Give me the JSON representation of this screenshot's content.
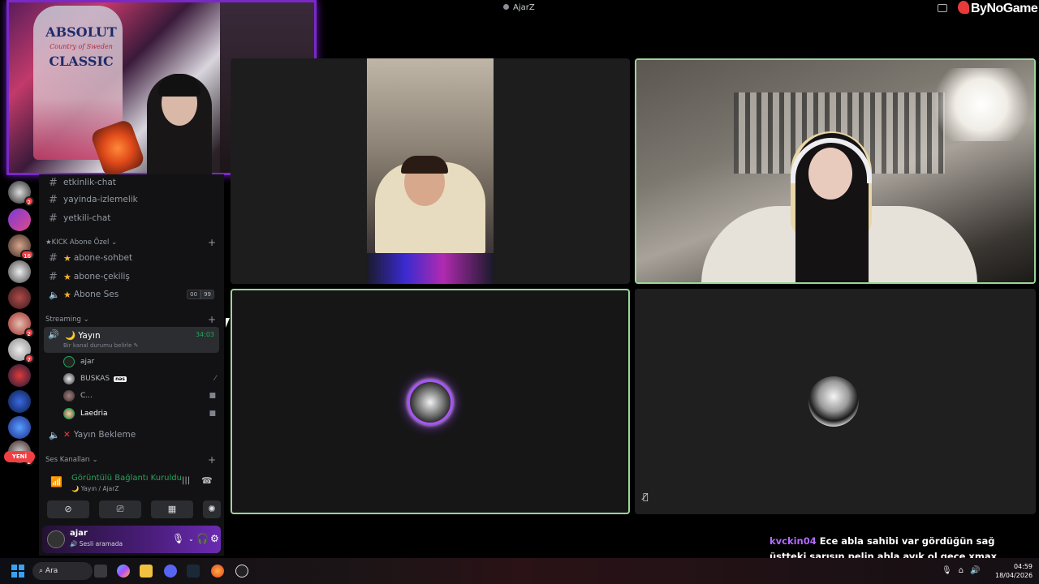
{
  "window": {
    "title": "AjarZ"
  },
  "overlay": {
    "brand": "ByNoGame",
    "webcam": {
      "bottle_line1": "ABSOLUT",
      "bottle_line2": "Country of Sweden",
      "bottle_line3": "CLASSIC"
    }
  },
  "rail": {
    "new_badge": "YENİ",
    "badges": [
      "2",
      "16",
      "2",
      "7",
      "2"
    ]
  },
  "sidebar": {
    "channels_top": [
      {
        "name": "etkinlik-chat"
      },
      {
        "name": "yayinda-izlemelik"
      },
      {
        "name": "yetkili-chat"
      }
    ],
    "category_kick": "KICK Abone Özel",
    "kick_channels": [
      {
        "name": "abone-sohbet"
      },
      {
        "name": "abone-çekiliş"
      },
      {
        "name": "Abone Ses",
        "count_a": "00",
        "count_b": "99"
      }
    ],
    "category_streaming": "Streaming",
    "active_channel": {
      "name": "Yayın",
      "time": "34:03",
      "status": "Bir kanal durumu belirle"
    },
    "members": [
      {
        "name": "ajar"
      },
      {
        "name": "BUSKAS",
        "tag": "nəs"
      },
      {
        "name": "C..."
      },
      {
        "name": "Laedria"
      }
    ],
    "waiting_channel": "Yayın Bekleme",
    "category_voice": "Ses Kanalları"
  },
  "voice_panel": {
    "status": "Görüntülü Bağlantı Kuruldu",
    "location": "Yayın / AjarZ"
  },
  "user_panel": {
    "username": "ajar",
    "status": "Sesli aramada"
  },
  "chat": {
    "user": "kvckin04",
    "message": "Ece abla sahibi var gördüğün sağ üstteki sarışın pelin abla ayık ol gece xmax motorlar papapap ayy"
  },
  "taskbar": {
    "search_label": "Ara",
    "time": "04:59",
    "date": "18/04/2026"
  },
  "colors": {
    "accent_green": "#23a55a",
    "speaking_border": "#9cd59a",
    "webcam_border": "#7a28c8",
    "chat_user": "#b36bff",
    "badge_red": "#f23f43"
  }
}
